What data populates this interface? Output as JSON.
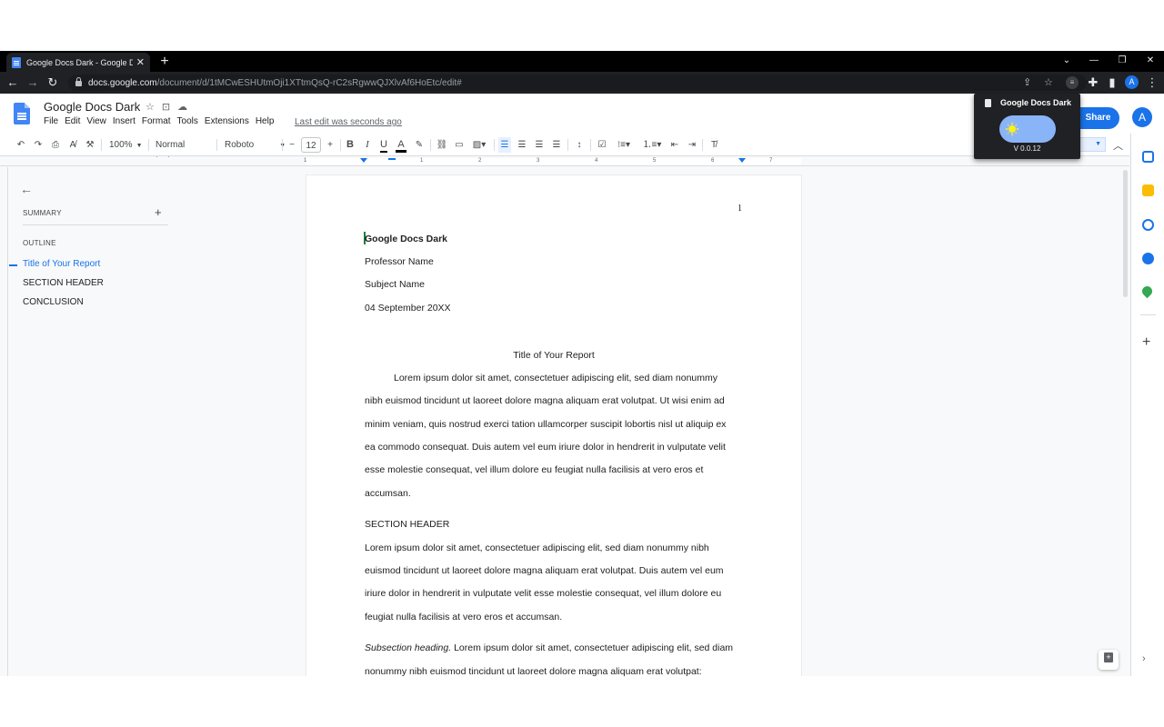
{
  "browser": {
    "tab_title": "Google Docs Dark - Google Docs",
    "tab_close": "✕",
    "new_tab": "+",
    "url_host": "docs.google.com",
    "url_path": "/document/d/1tMCwESHUtmOji1XTtmQsQ-rC2sRgwwQJXlvAf6HoEtc/edit#",
    "profile_initial": "A"
  },
  "docs": {
    "title": "Google Docs Dark",
    "menu": [
      "File",
      "Edit",
      "View",
      "Insert",
      "Format",
      "Tools",
      "Extensions",
      "Help"
    ],
    "last_edit": "Last edit was seconds ago",
    "share_label": "Share",
    "avatar_initial": "A"
  },
  "toolbar": {
    "zoom": "100%",
    "style": "Normal text",
    "font": "Roboto",
    "font_size": "12",
    "bold": "B",
    "italic": "I",
    "underline": "U",
    "text_color": "A"
  },
  "ruler": {
    "ticks": [
      "1",
      "1",
      "2",
      "3",
      "4",
      "5",
      "6",
      "7"
    ]
  },
  "outline": {
    "summary_label": "SUMMARY",
    "outline_label": "OUTLINE",
    "items": [
      "Title of Your Report",
      "SECTION HEADER",
      "CONCLUSION"
    ]
  },
  "page": {
    "number": "1",
    "lines": [
      "Google Docs Dark",
      "Professor Name",
      "Subject Name",
      "04 September 20XX",
      "Title of Your Report",
      "Lorem ipsum dolor sit amet, consectetuer adipiscing elit, sed diam nonummy",
      "nibh euismod tincidunt ut laoreet dolore magna aliquam erat volutpat. Ut wisi enim ad",
      "minim veniam, quis nostrud exerci tation ullamcorper suscipit lobortis nisl ut aliquip ex",
      "ea commodo consequat. Duis autem vel eum iriure dolor in hendrerit in vulputate velit",
      "esse molestie consequat, vel illum dolore eu feugiat nulla facilisis at vero eros et",
      "accumsan.",
      "SECTION HEADER",
      "Lorem ipsum dolor sit amet, consectetuer adipiscing elit, sed diam nonummy nibh",
      "euismod tincidunt ut laoreet dolore magna aliquam erat volutpat. Duis autem vel eum",
      "iriure dolor in hendrerit in vulputate velit esse molestie consequat, vel illum dolore eu",
      "feugiat nulla facilisis at vero eros et accumsan.",
      "Subsection heading.",
      " Lorem ipsum dolor sit amet, consectetuer adipiscing elit, sed diam",
      "nonummy nibh euismod tincidunt ut laoreet dolore magna aliquam erat volutpat:"
    ]
  },
  "extension": {
    "title": "Google Docs Dark",
    "version": "V 0.0.12",
    "toggle_state": "light"
  },
  "colors": {
    "accent": "#1a73e8",
    "chrome_dark": "#202124",
    "toggle_bg": "#8ab4f8",
    "sun": "#fbef1f"
  }
}
